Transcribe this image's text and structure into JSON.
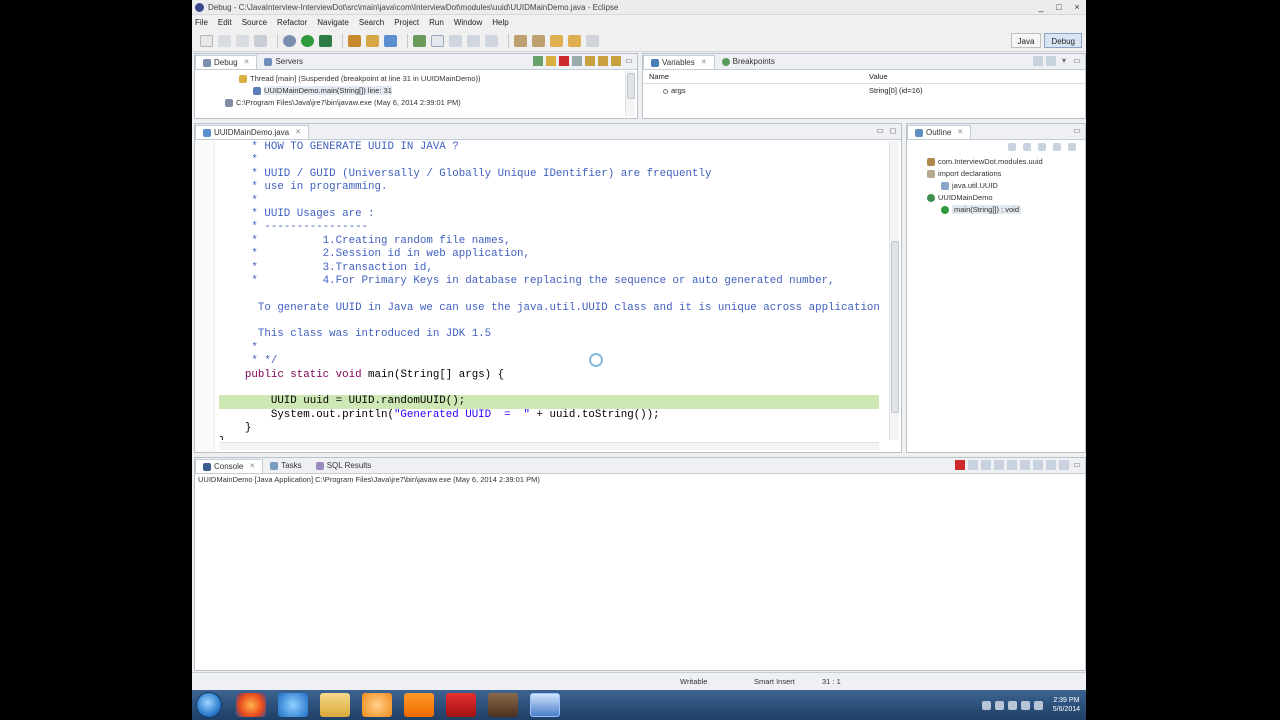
{
  "window": {
    "title": "Debug - C:\\JavaInterview-InterviewDot\\src\\main\\java\\com\\InterviewDot\\modules\\uuid\\UUIDMainDemo.java - Eclipse",
    "controls": [
      "_",
      "□",
      "×"
    ]
  },
  "menu": [
    "File",
    "Edit",
    "Source",
    "Refactor",
    "Navigate",
    "Search",
    "Project",
    "Run",
    "Window",
    "Help"
  ],
  "perspectives": {
    "java": "Java",
    "debug": "Debug"
  },
  "debug_view": {
    "tabs": [
      {
        "label": "Debug",
        "active": true
      },
      {
        "label": "Servers",
        "active": false
      }
    ],
    "rows": [
      "Thread [main] (Suspended (breakpoint at line 31 in UUIDMainDemo))",
      "UUIDMainDemo.main(String[]) line: 31",
      "C:\\Program Files\\Java\\jre7\\bin\\javaw.exe (May 6, 2014 2:39:01 PM)"
    ]
  },
  "variables_view": {
    "tabs": [
      {
        "label": "Variables",
        "active": true
      },
      {
        "label": "Breakpoints",
        "active": false
      }
    ],
    "columns": [
      "Name",
      "Value"
    ],
    "rows": [
      {
        "name": "args",
        "value": "String[0]  (id=16)"
      }
    ]
  },
  "editor": {
    "tab": "UUIDMainDemo.java",
    "lines": [
      {
        "parts": [
          {
            "t": "     * HOW TO GENERATE UUID IN JAVA ?",
            "c": "cm"
          }
        ]
      },
      {
        "parts": [
          {
            "t": "     *",
            "c": "cm"
          }
        ]
      },
      {
        "parts": [
          {
            "t": "     * UUID / GUID (Universally / Globally Unique IDentifier) are frequently",
            "c": "cm"
          }
        ]
      },
      {
        "parts": [
          {
            "t": "     * use in programming.",
            "c": "cm"
          }
        ]
      },
      {
        "parts": [
          {
            "t": "     *",
            "c": "cm"
          }
        ]
      },
      {
        "parts": [
          {
            "t": "     * UUID Usages are :",
            "c": "cm"
          }
        ]
      },
      {
        "parts": [
          {
            "t": "     * ----------------",
            "c": "cm"
          }
        ]
      },
      {
        "parts": [
          {
            "t": "     *          1.Creating random file names,",
            "c": "cm"
          }
        ]
      },
      {
        "parts": [
          {
            "t": "     *          2.Session id in web application,",
            "c": "cm"
          }
        ]
      },
      {
        "parts": [
          {
            "t": "     *          3.Transaction id,",
            "c": "cm"
          }
        ]
      },
      {
        "parts": [
          {
            "t": "     *          4.For Primary Keys in database replacing the sequence or auto generated number,",
            "c": "cm"
          }
        ]
      },
      {
        "parts": [
          {
            "t": "",
            "c": "cm"
          }
        ]
      },
      {
        "parts": [
          {
            "t": "      To generate UUID in Java we can use the java.util.UUID class and it is unique across application",
            "c": "cm"
          }
        ]
      },
      {
        "parts": [
          {
            "t": "",
            "c": "cm"
          }
        ]
      },
      {
        "parts": [
          {
            "t": "      This class was introduced in JDK 1.5",
            "c": "cm"
          }
        ]
      },
      {
        "parts": [
          {
            "t": "     *",
            "c": "cm"
          }
        ]
      },
      {
        "parts": [
          {
            "t": "     * */",
            "c": "cm"
          }
        ]
      },
      {
        "parts": [
          {
            "t": "    ",
            "c": "pl"
          },
          {
            "t": "public static void",
            "c": "kw"
          },
          {
            "t": " main(String[] args) {",
            "c": "pl"
          }
        ]
      },
      {
        "parts": [
          {
            "t": "",
            "c": "pl"
          }
        ]
      },
      {
        "parts": [
          {
            "t": "        UUID uuid = UUID.randomUUID();",
            "c": "pl"
          }
        ],
        "highlight": true
      },
      {
        "parts": [
          {
            "t": "        System.out.println(",
            "c": "pl"
          },
          {
            "t": "\"Generated UUID  =  \"",
            "c": "st"
          },
          {
            "t": " + uuid.toString());",
            "c": "pl"
          }
        ]
      },
      {
        "parts": [
          {
            "t": "    }",
            "c": "pl"
          }
        ]
      },
      {
        "parts": [
          {
            "t": "}",
            "c": "pl"
          }
        ]
      }
    ]
  },
  "outline_view": {
    "tab": "Outline",
    "rows": [
      {
        "label": "com.InterviewDot.modules.uuid",
        "indent": 0
      },
      {
        "label": "import declarations",
        "indent": 0
      },
      {
        "label": "java.util.UUID",
        "indent": 1
      },
      {
        "label": "UUIDMainDemo",
        "indent": 0
      },
      {
        "label": "main(String[]) : void",
        "indent": 1,
        "selected": true
      }
    ]
  },
  "console_view": {
    "tabs": [
      {
        "label": "Console",
        "active": true
      },
      {
        "label": "Tasks",
        "active": false
      },
      {
        "label": "SQL Results",
        "active": false
      }
    ],
    "process": "UUIDMainDemo [Java Application] C:\\Program Files\\Java\\jre7\\bin\\javaw.exe (May 6, 2014 2:39:01 PM)"
  },
  "status_bar": {
    "writable": "Writable",
    "insert_mode": "Smart Insert",
    "position": "31 : 1"
  },
  "taskbar": {
    "apps": [
      "firefox-icon",
      "ie-icon",
      "folder-icon",
      "media-player-icon",
      "vlc-icon",
      "filezilla-icon",
      "gimp-icon",
      "save-icon"
    ],
    "clock": {
      "time": "2:39 PM",
      "date": "5/6/2014"
    }
  },
  "colors": {
    "comment": "#3f5fbf",
    "keyword": "#7f0055",
    "string": "#2a00ff",
    "current_line": "#cde8b4"
  }
}
